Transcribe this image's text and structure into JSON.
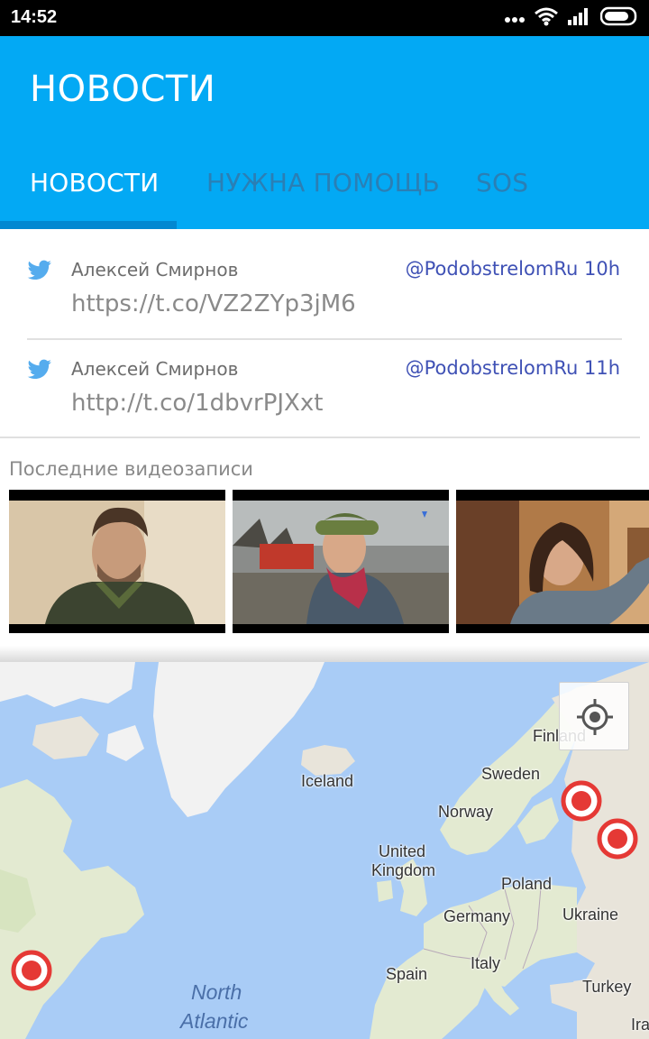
{
  "status_bar": {
    "time": "14:52"
  },
  "app_bar": {
    "title": "НОВОСТИ"
  },
  "tabs": [
    {
      "label": "НОВОСТИ",
      "active": true
    },
    {
      "label": "НУЖНА ПОМОЩЬ",
      "active": false
    },
    {
      "label": "SOS",
      "active": false
    }
  ],
  "tweets": [
    {
      "author": "Алексей Смирнов",
      "handle": "@PodobstrelomRu",
      "age": "10h",
      "text": "https://t.co/VZ2ZYp3jM6"
    },
    {
      "author": "Алексей Смирнов",
      "handle": "@PodobstrelomRu",
      "age": "11h",
      "text": "http://t.co/1dbvrPJXxt"
    }
  ],
  "videos": {
    "title": "Последние видеозаписи",
    "items": [
      {
        "name": "video-thumbnail-man"
      },
      {
        "name": "video-thumbnail-old-woman"
      },
      {
        "name": "video-thumbnail-woman"
      }
    ]
  },
  "map": {
    "labels": {
      "finland": "Finland",
      "sweden": "Sweden",
      "iceland": "Iceland",
      "norway": "Norway",
      "united_kingdom_1": "United",
      "united_kingdom_2": "Kingdom",
      "poland": "Poland",
      "germany": "Germany",
      "ukraine": "Ukraine",
      "italy": "Italy",
      "spain": "Spain",
      "turkey": "Turkey",
      "iraq": "Ira",
      "ocean_1": "North",
      "ocean_2": "Atlantic"
    },
    "marker_color": "#e53935",
    "land_color": "#e8e4da",
    "water_color": "#a9ccf6"
  },
  "colors": {
    "app_bar": "#03a9f4",
    "tab_indicator": "#0288d1",
    "handle": "#3f51b5",
    "twitter": "#55acee"
  }
}
